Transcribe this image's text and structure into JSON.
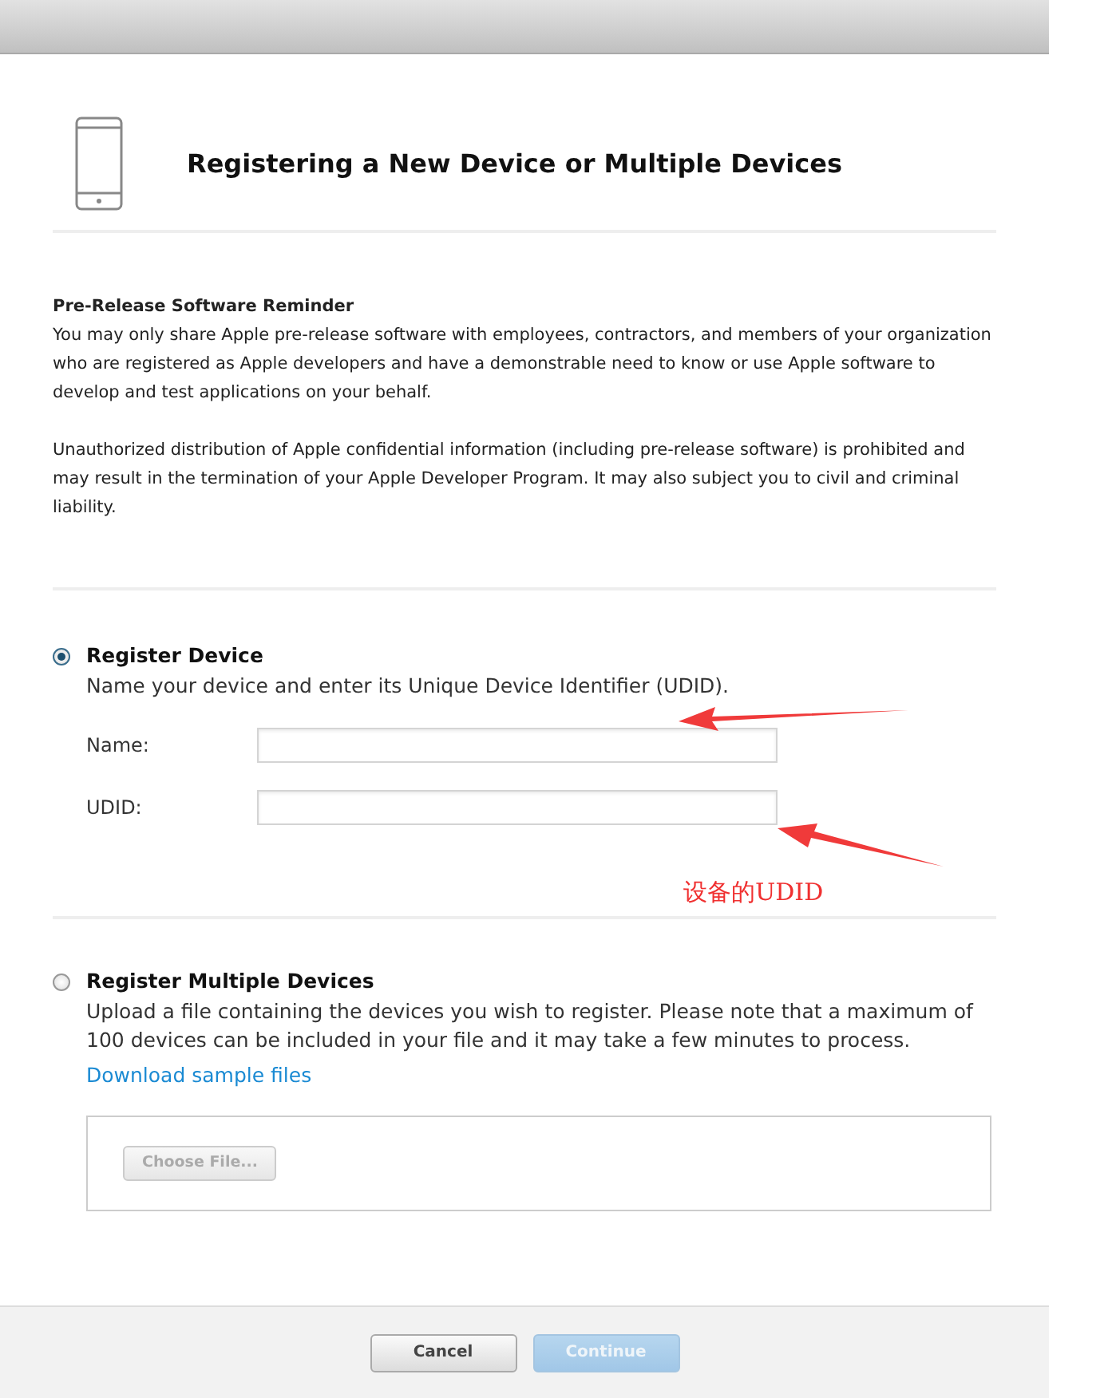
{
  "header": {
    "title": "Registering a New Device or Multiple Devices"
  },
  "reminder": {
    "heading": "Pre-Release Software Reminder",
    "paragraphs": [
      "You may only share Apple pre-release software with employees, contractors, and members of your organization who are registered as Apple developers and have a demonstrable need to know or use Apple software to develop and test applications on your behalf.",
      "Unauthorized distribution of Apple confidential information (including pre-release software) is prohibited and may result in the termination of your Apple Developer Program. It may also subject you to civil and criminal liability."
    ]
  },
  "options": [
    {
      "kind": "single",
      "label": "Register Device",
      "selected": true,
      "description": "Name your device and enter its Unique Device Identifier (UDID).",
      "fields": [
        {
          "label": "Name:"
        },
        {
          "label": "UDID:"
        }
      ]
    },
    {
      "kind": "multiple",
      "label": "Register Multiple Devices",
      "selected": false,
      "description": "Upload a file containing the devices you wish to register. Please note that a maximum of 100 devices can be included in your file and it may take a few minutes to process.",
      "link": "Download sample files",
      "file_button": {
        "label": "Choose File...",
        "disabled": true
      }
    }
  ],
  "annotation": {
    "text": "设备的UDID"
  },
  "footer": {
    "buttons": [
      {
        "label": "Cancel",
        "kind": "secondary",
        "disabled": false
      },
      {
        "label": "Continue",
        "kind": "primary",
        "disabled": true
      }
    ]
  }
}
